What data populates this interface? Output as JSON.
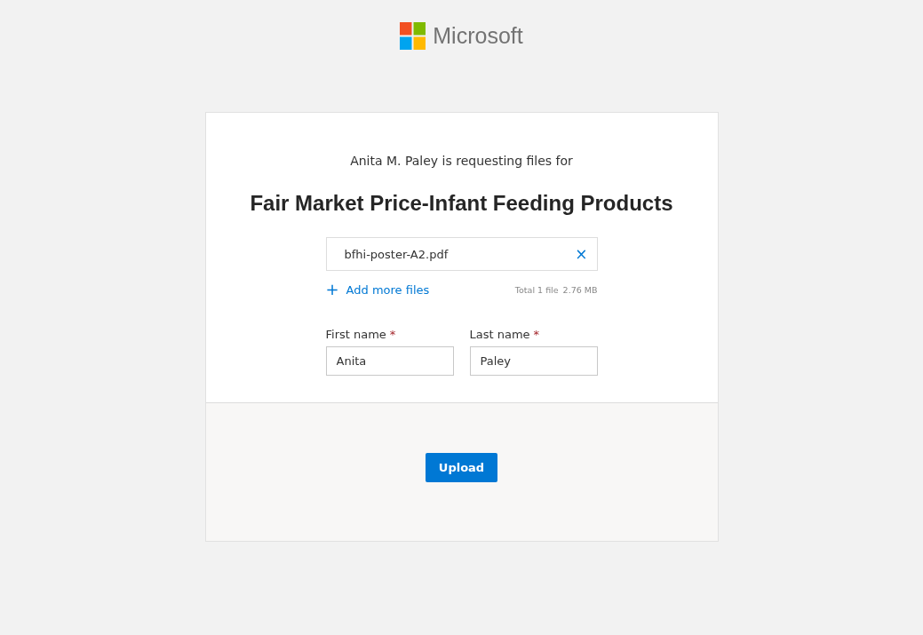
{
  "logo": {
    "text": "Microsoft"
  },
  "request": {
    "intro": "Anita M. Paley is requesting files for",
    "title": "Fair Market Price-Infant Feeding Products"
  },
  "files": [
    {
      "name": "bfhi-poster-A2.pdf",
      "remove": "×"
    }
  ],
  "add_files": {
    "icon": "+",
    "label": "Add more files"
  },
  "totals": {
    "count": "Total 1 file",
    "size": "2.76 MB"
  },
  "fields": [
    {
      "label": "First name",
      "required_mark": "*",
      "value": "Anita"
    },
    {
      "label": "Last name",
      "required_mark": "*",
      "value": "Paley"
    }
  ],
  "submit": {
    "label": "Upload"
  }
}
